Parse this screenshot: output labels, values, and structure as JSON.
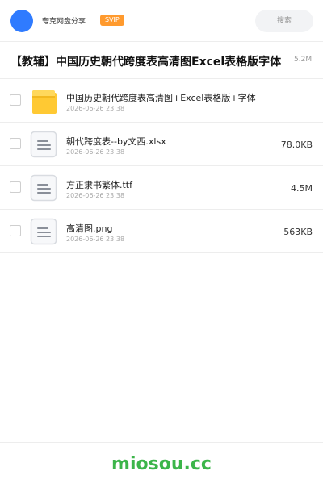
{
  "header": {
    "brand": "夸克网盘分享",
    "badge": "SVIP",
    "search_label": "搜索"
  },
  "share": {
    "title": "【教辅】中国历史朝代跨度表高清图Excel表格版字体",
    "total_size": "5.2M"
  },
  "files": [
    {
      "name": "中国历史朝代跨度表高清图+Excel表格版+字体",
      "date": "2026-06-26 23:38",
      "size": "",
      "icon": "folder-icon"
    },
    {
      "name": "朝代跨度表--by文西.xlsx",
      "date": "2026-06-26 23:38",
      "size": "78.0KB",
      "icon": "document-icon"
    },
    {
      "name": "方正隶书繁体.ttf",
      "date": "2026-06-26 23:38",
      "size": "4.5M",
      "icon": "document-icon"
    },
    {
      "name": "高清图.png",
      "date": "2026-06-26 23:38",
      "size": "563KB",
      "icon": "document-icon"
    }
  ],
  "footer": {
    "site": "miosou.cc"
  },
  "colors": {
    "accent": "#2f7bff",
    "badge": "#ff9a2e",
    "folder": "#ffc933",
    "site": "#3cb54a"
  }
}
